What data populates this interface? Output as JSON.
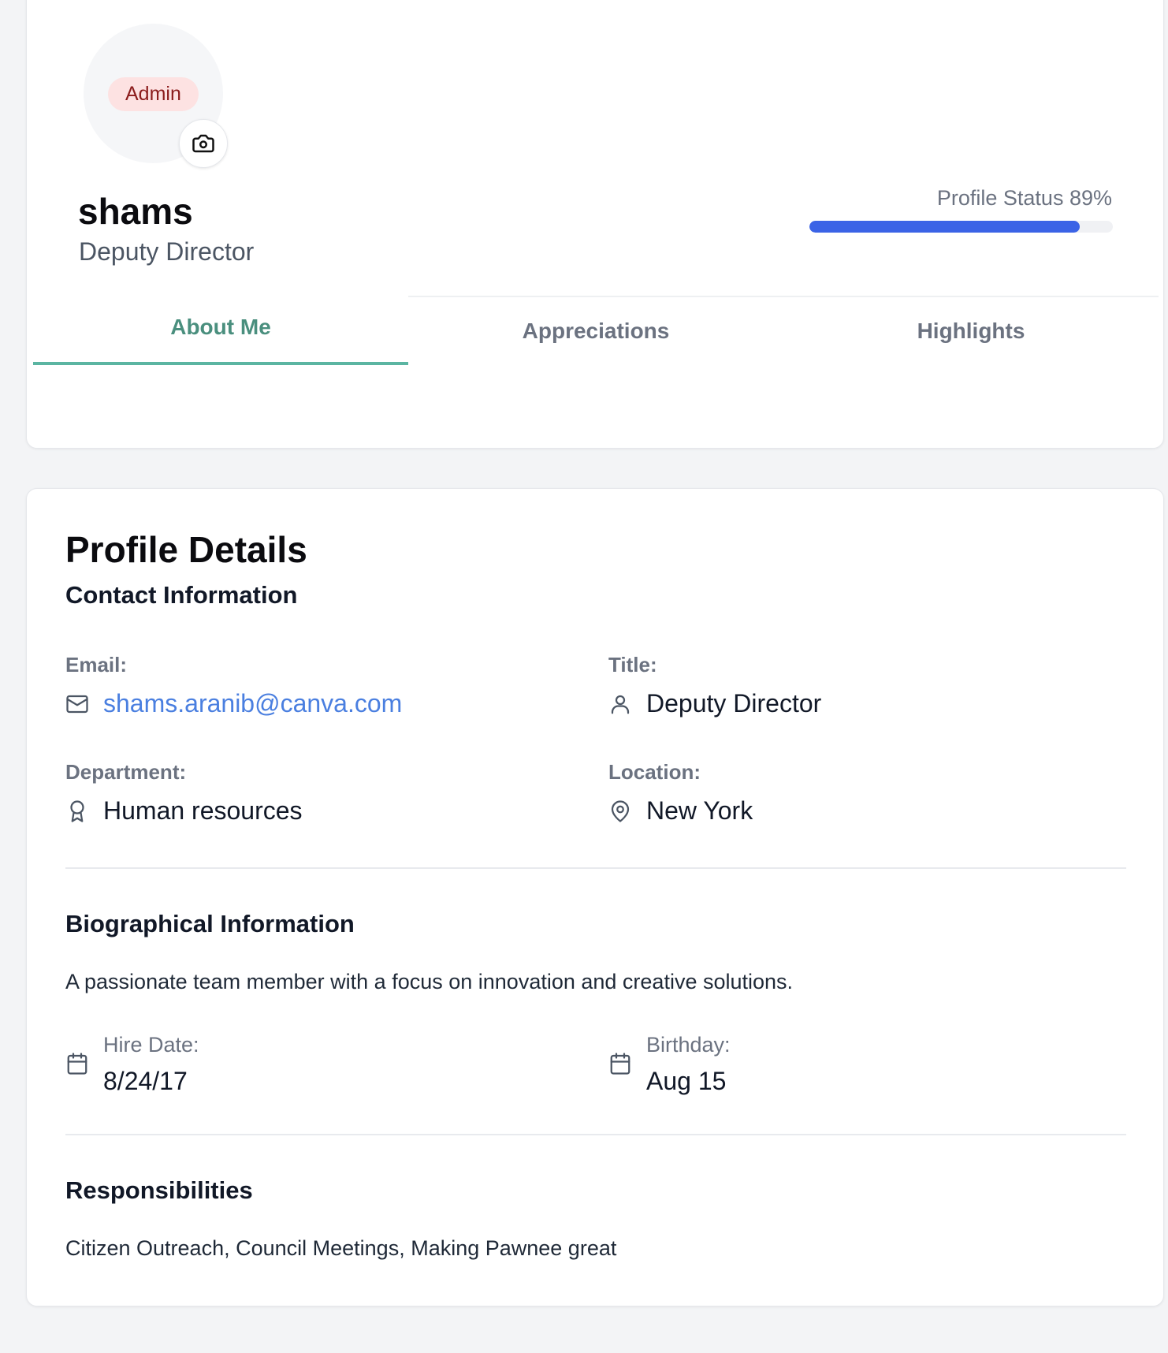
{
  "profile": {
    "role_badge": "Admin",
    "name": "shams",
    "title": "Deputy Director",
    "status_label": "Profile Status 89%",
    "status_percent": 89,
    "accent_color": "#3b63e6"
  },
  "tabs": [
    {
      "label": "About Me",
      "active": true
    },
    {
      "label": "Appreciations",
      "active": false
    },
    {
      "label": "Highlights",
      "active": false
    }
  ],
  "details": {
    "heading": "Profile Details",
    "contact": {
      "heading": "Contact Information",
      "email_label": "Email:",
      "email_value": "shams.aranib@canva.com",
      "title_label": "Title:",
      "title_value": "Deputy Director",
      "department_label": "Department:",
      "department_value": "Human resources",
      "location_label": "Location:",
      "location_value": "New York"
    },
    "bio": {
      "heading": "Biographical Information",
      "text": "A passionate team member with a focus on innovation and creative solutions.",
      "hire_label": "Hire Date:",
      "hire_value": "8/24/17",
      "birthday_label": "Birthday:",
      "birthday_value": "Aug 15"
    },
    "responsibilities": {
      "heading": "Responsibilities",
      "text": "Citizen Outreach, Council Meetings, Making Pawnee great"
    }
  },
  "icons": {
    "camera": "camera-icon",
    "email": "mail-icon",
    "title": "user-icon",
    "department": "award-icon",
    "location": "map-pin-icon",
    "hire": "calendar-icon",
    "birthday": "calendar-icon"
  }
}
